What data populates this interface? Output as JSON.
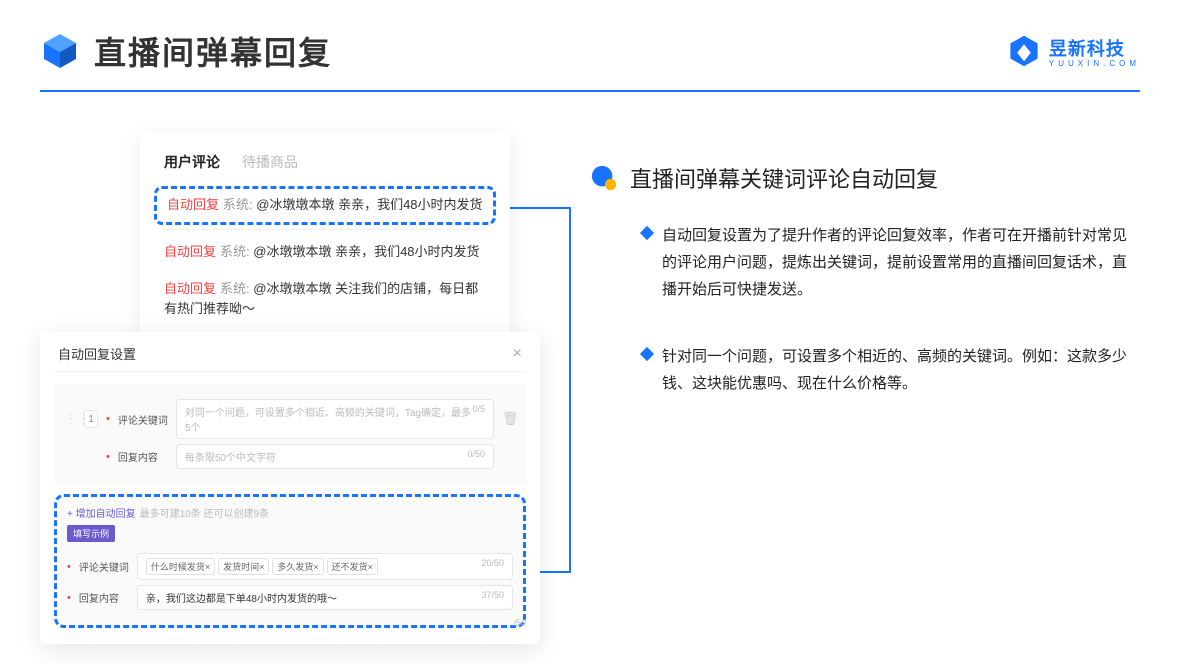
{
  "header": {
    "title": "直播间弹幕回复",
    "brand_name": "昱新科技",
    "brand_sub": "YUUXIN.COM"
  },
  "comment_card": {
    "tabs": {
      "active": "用户评论",
      "inactive": "待播商品"
    },
    "items": [
      {
        "badge": "自动回复",
        "sys": "系统:",
        "text": "@冰墩墩本墩 亲亲，我们48小时内发货"
      },
      {
        "badge": "自动回复",
        "sys": "系统:",
        "text": "@冰墩墩本墩 亲亲，我们48小时内发货"
      },
      {
        "badge": "自动回复",
        "sys": "系统:",
        "text": "@冰墩墩本墩 关注我们的店铺，每日都有热门推荐呦～"
      }
    ]
  },
  "settings": {
    "title": "自动回复设置",
    "row1": {
      "num": "1",
      "label": "评论关键词",
      "placeholder": "对同一个问题，可设置多个相近、高频的关键词，Tag确定，最多5个",
      "counter": "0/5"
    },
    "row2": {
      "label": "回复内容",
      "placeholder": "每条限50个中文字符",
      "counter": "0/50"
    },
    "example": {
      "add_link": "+ 增加自动回复",
      "add_muted": "最多可建10条 还可以创建9条",
      "badge": "填写示例",
      "kw_label": "评论关键词",
      "tags": [
        "什么时候发货×",
        "发货时间×",
        "多久发货×",
        "还不发货×"
      ],
      "kw_counter": "20/50",
      "reply_label": "回复内容",
      "reply_value": "亲，我们这边都是下单48小时内发货的哦～",
      "reply_counter": "37/50"
    },
    "stray_counter": "/50"
  },
  "right": {
    "section_title": "直播间弹幕关键词评论自动回复",
    "bullets": [
      "自动回复设置为了提升作者的评论回复效率，作者可在开播前针对常见的评论用户问题，提炼出关键词，提前设置常用的直播间回复话术，直播开始后可快捷发送。",
      "针对同一个问题，可设置多个相近的、高频的关键词。例如：这款多少钱、这块能优惠吗、现在什么价格等。"
    ]
  }
}
